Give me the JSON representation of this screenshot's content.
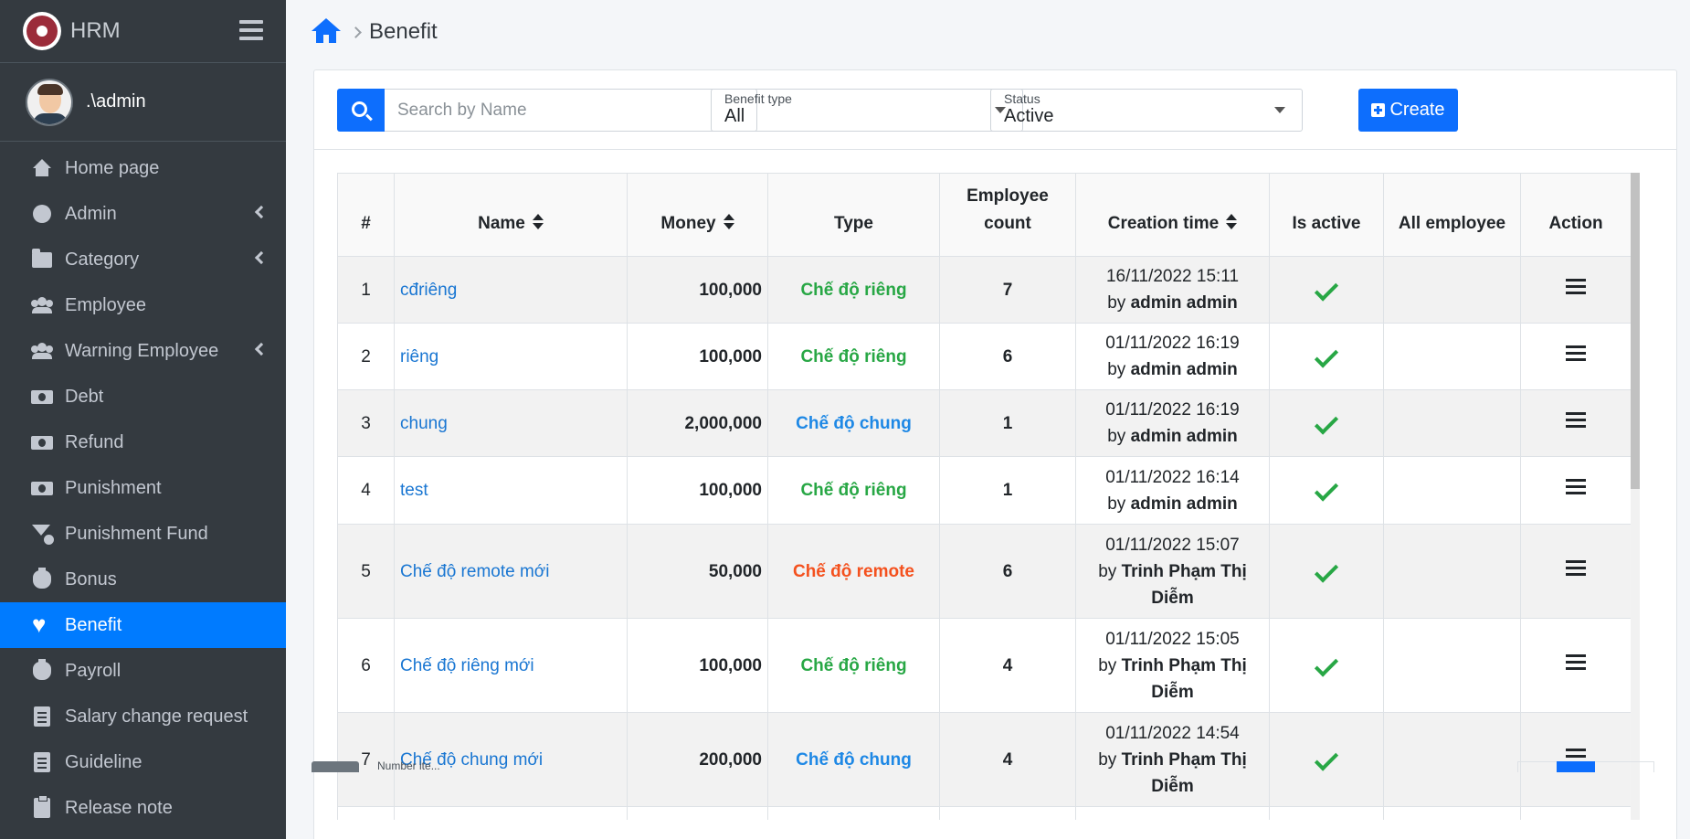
{
  "app": {
    "name": "HRM",
    "user": ".\\admin"
  },
  "sidebar": {
    "items": [
      {
        "label": "Home page",
        "icon": "home-icon"
      },
      {
        "label": "Admin",
        "icon": "circle-icon"
      },
      {
        "label": "Category",
        "icon": "folder-icon"
      },
      {
        "label": "Employee",
        "icon": "users-icon"
      },
      {
        "label": "Warning Employee",
        "icon": "users-icon"
      },
      {
        "label": "Debt",
        "icon": "money-bill-icon"
      },
      {
        "label": "Refund",
        "icon": "money-bill-icon"
      },
      {
        "label": "Punishment",
        "icon": "money-check-icon"
      },
      {
        "label": "Punishment Fund",
        "icon": "funnel-dollar-icon"
      },
      {
        "label": "Bonus",
        "icon": "money-bag-icon"
      },
      {
        "label": "Benefit",
        "icon": "hand-holding-heart-icon"
      },
      {
        "label": "Payroll",
        "icon": "money-bag-icon"
      },
      {
        "label": "Salary change request",
        "icon": "file-invoice-dollar-icon"
      },
      {
        "label": "Guideline",
        "icon": "book-icon"
      },
      {
        "label": "Release note",
        "icon": "clipboard-icon"
      }
    ],
    "active": "Benefit"
  },
  "breadcrumb": {
    "title": "Benefit"
  },
  "toolbar": {
    "search_placeholder": "Search by Name",
    "benefit_type": {
      "label": "Benefit type",
      "value": "All"
    },
    "status": {
      "label": "Status",
      "value": "Active"
    },
    "create_label": "Create"
  },
  "table": {
    "headers": {
      "index": "#",
      "name": "Name",
      "money": "Money",
      "type": "Type",
      "employee_count_1": "Employee",
      "employee_count_2": "count",
      "creation_time": "Creation time",
      "is_active": "Is active",
      "all_employee": "All employee",
      "action": "Action"
    },
    "by_prefix": "by",
    "rows": [
      {
        "index": "1",
        "name": "cđriêng",
        "money": "100,000",
        "type": "Chế độ riêng",
        "count": "7",
        "date": "16/11/2022 15:11",
        "by": "admin admin"
      },
      {
        "index": "2",
        "name": "riêng",
        "money": "100,000",
        "type": "Chế độ riêng",
        "count": "6",
        "date": "01/11/2022 16:19",
        "by": "admin admin"
      },
      {
        "index": "3",
        "name": "chung",
        "money": "2,000,000",
        "type": "Chế độ chung",
        "count": "1",
        "date": "01/11/2022 16:19",
        "by": "admin admin"
      },
      {
        "index": "4",
        "name": "test",
        "money": "100,000",
        "type": "Chế độ riêng",
        "count": "1",
        "date": "01/11/2022 16:14",
        "by": "admin admin"
      },
      {
        "index": "5",
        "name": "Chế độ remote mới",
        "money": "50,000",
        "type": "Chế độ remote",
        "count": "6",
        "date": "01/11/2022 15:07",
        "by": "Trinh Phạm Thị Diễm"
      },
      {
        "index": "6",
        "name": "Chế độ riêng mới",
        "money": "100,000",
        "type": "Chế độ riêng",
        "count": "4",
        "date": "01/11/2022 15:05",
        "by": "Trinh Phạm Thị Diễm"
      },
      {
        "index": "7",
        "name": "Chế độ chung mới",
        "money": "200,000",
        "type": "Chế độ chung",
        "count": "4",
        "date": "01/11/2022 14:54",
        "by": "Trinh Phạm Thị Diễm"
      }
    ]
  },
  "footer": {
    "page_size_label": "Number ite..."
  },
  "colors": {
    "primary": "#0d6efd",
    "sidebar": "#343a40",
    "green": "#28a745",
    "blue": "#1e88e5",
    "red": "#f4511e"
  }
}
